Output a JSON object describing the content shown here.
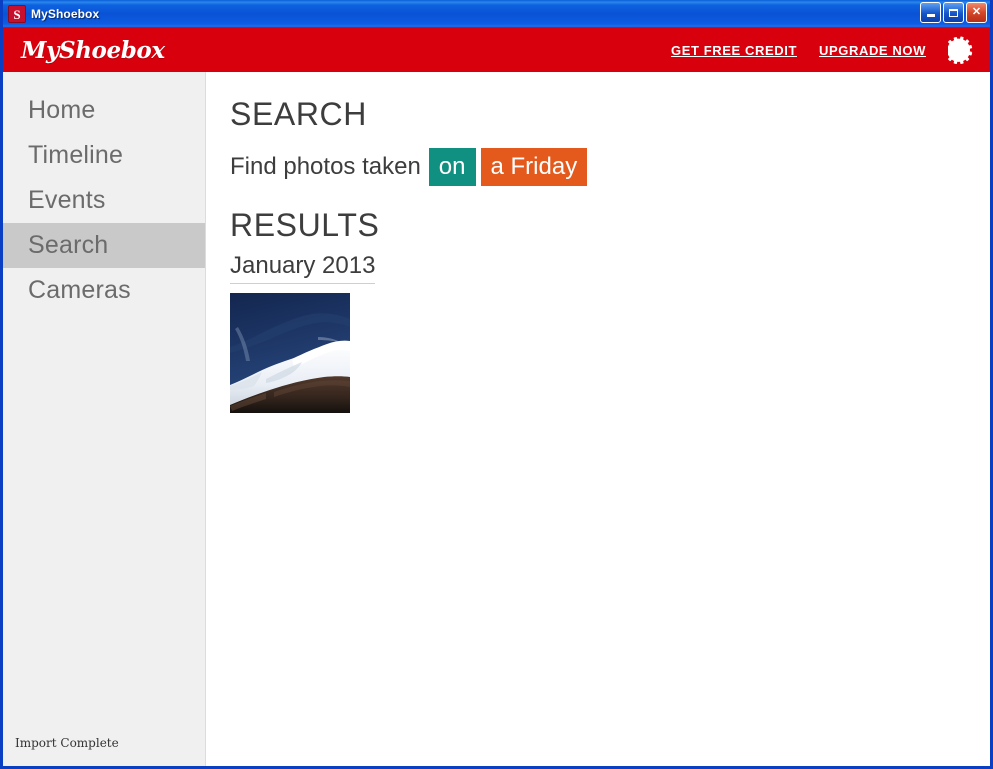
{
  "window": {
    "title": "MyShoebox",
    "app_icon": "shoebox-s-icon",
    "controls": {
      "minimize": "minimize-icon",
      "maximize": "maximize-icon",
      "close": "✕"
    }
  },
  "header": {
    "brand": "MyShoebox",
    "links": [
      {
        "label": "GET FREE CREDIT",
        "name": "get-free-credit-link"
      },
      {
        "label": "UPGRADE NOW",
        "name": "upgrade-now-link"
      }
    ],
    "settings_icon": "gear-icon"
  },
  "sidebar": {
    "items": [
      {
        "label": "Home",
        "name": "sidebar-item-home",
        "active": false
      },
      {
        "label": "Timeline",
        "name": "sidebar-item-timeline",
        "active": false
      },
      {
        "label": "Events",
        "name": "sidebar-item-events",
        "active": false
      },
      {
        "label": "Search",
        "name": "sidebar-item-search",
        "active": true
      },
      {
        "label": "Cameras",
        "name": "sidebar-item-cameras",
        "active": false
      }
    ],
    "status": "Import Complete"
  },
  "main": {
    "search_heading": "SEARCH",
    "query": {
      "prefix": "Find photos taken",
      "token_relation": "on",
      "token_value": "a Friday"
    },
    "results_heading": "RESULTS",
    "groups": [
      {
        "month": "January 2013",
        "photos": [
          {
            "name": "photo-thumbnail",
            "alt": "snow-capped-mountain-under-deep-blue-sky"
          }
        ]
      }
    ]
  },
  "colors": {
    "brand_red": "#d8000c",
    "token_teal": "#0f9080",
    "token_orange": "#e35a1c",
    "sidebar_bg": "#f0f0f0",
    "sidebar_active": "#c9c9c9",
    "titlebar_blue": "#0a52d6",
    "text_dark": "#3d3d3d"
  }
}
